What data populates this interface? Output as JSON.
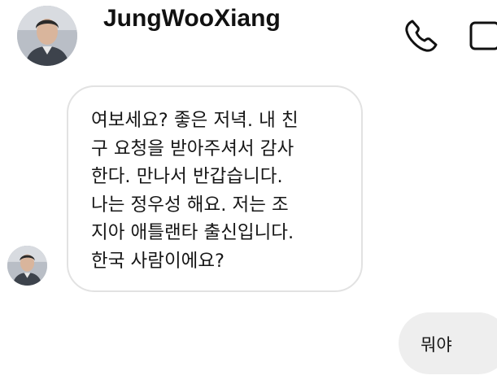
{
  "header": {
    "contact_name": "JungWooXiang",
    "avatar_icon": "person-avatar-icon",
    "call_icon": "phone-icon",
    "video_icon": "video-call-icon"
  },
  "messages": [
    {
      "direction": "incoming",
      "text": "여보세요? 좋은 저녁. 내 친\n구 요청을 받아주셔서 감사\n한다. 만나서 반갑습니다.\n나는 정우성 해요. 저는 조\n지아 애틀랜타 출신입니다.\n한국 사람이에요?"
    },
    {
      "direction": "outgoing",
      "text": "뭐야"
    }
  ],
  "colors": {
    "incoming_bubble_border": "#e2e2e2",
    "outgoing_bubble_fill": "#eeeeee",
    "text": "#161616"
  }
}
